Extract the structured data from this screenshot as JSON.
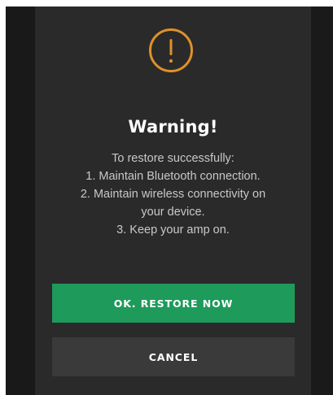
{
  "dialog": {
    "icon": "warning-exclamation-icon",
    "title": "Warning!",
    "message_lines": [
      "To restore successfully:",
      "1. Maintain Bluetooth connection.",
      "2. Maintain wireless connectivity on",
      "your device.",
      "3. Keep your amp on."
    ],
    "primary_button_label": "OK. RESTORE NOW",
    "secondary_button_label": "CANCEL"
  },
  "colors": {
    "background": "#252525",
    "dialog_background": "#2a2a2a",
    "accent_warning": "#e0902a",
    "primary_button": "#1e9a5a",
    "secondary_button": "#3a3a3a",
    "title_text": "#ffffff",
    "body_text": "#c8c8c8"
  }
}
